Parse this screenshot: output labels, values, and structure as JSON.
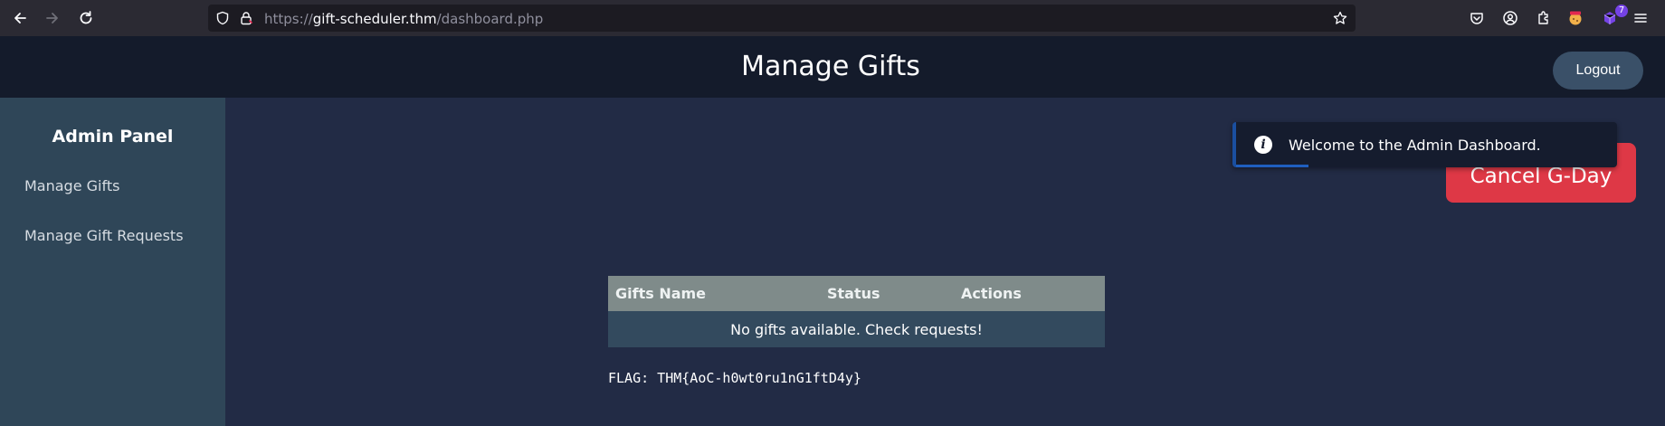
{
  "browser": {
    "url_prefix": "https://",
    "url_host": "gift-scheduler.thm",
    "url_path": "/dashboard.php",
    "extension_badge": "7"
  },
  "header": {
    "title": "Manage Gifts",
    "logout_label": "Logout"
  },
  "sidebar": {
    "title": "Admin Panel",
    "items": [
      {
        "label": "Manage Gifts"
      },
      {
        "label": "Manage Gift Requests"
      }
    ]
  },
  "main": {
    "cancel_button_label": "Cancel G-Day",
    "toast_message": "Welcome to the Admin Dashboard.",
    "table": {
      "columns": [
        "Gifts Name",
        "Status",
        "Actions"
      ],
      "empty_message": "No gifts available. Check requests!"
    },
    "flag_text": "FLAG: THM{AoC-h0wt0ru1nG1ftD4y}"
  },
  "colors": {
    "header_bg": "#141b2b",
    "sidebar_bg": "#2f4658",
    "main_bg": "#222b45",
    "cancel_button": "#de3846",
    "logout_button": "#3a5068",
    "table_header": "#7f8b8a",
    "table_row": "#334a5e"
  }
}
